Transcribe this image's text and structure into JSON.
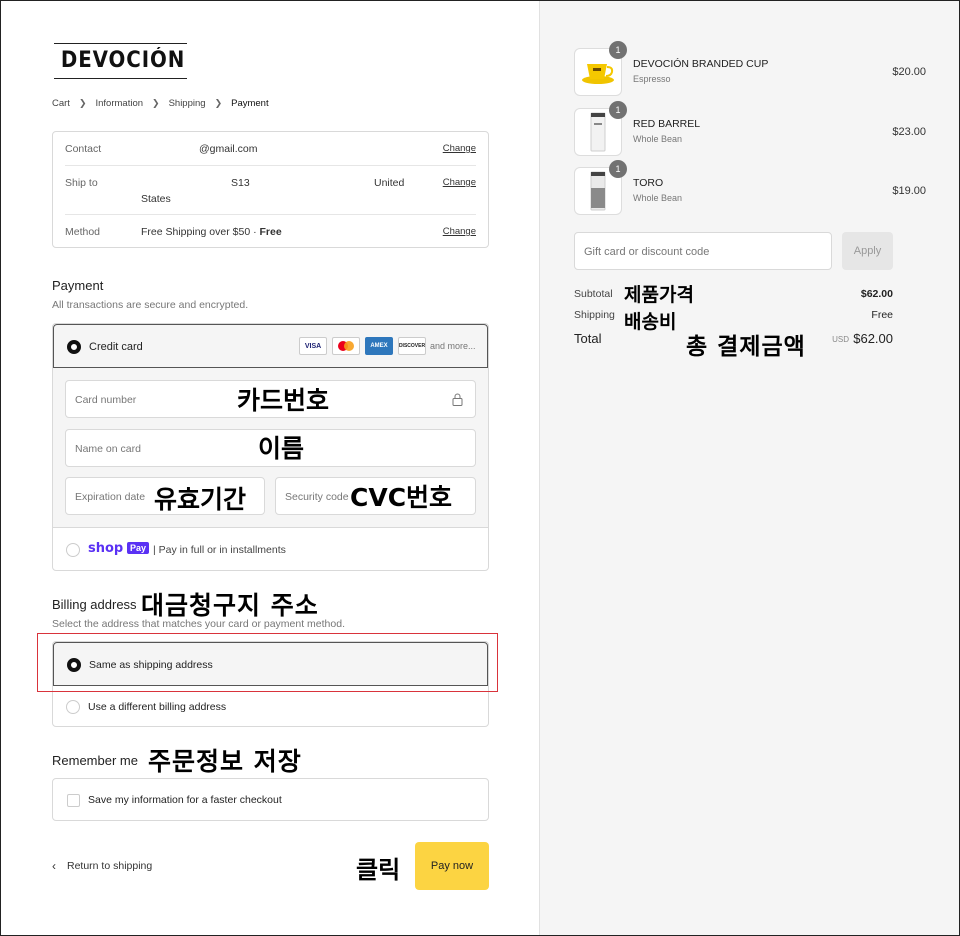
{
  "brand": {
    "logo_text": "DEVOCIÓN"
  },
  "breadcrumb": [
    "Cart",
    "Information",
    "Shipping",
    "Payment"
  ],
  "summary": {
    "contact_label": "Contact",
    "contact_value": "@gmail.com",
    "ship_label": "Ship to",
    "ship_value_a": "S13",
    "ship_value_b": "United",
    "ship_value_c": "States",
    "method_label": "Method",
    "method_value": "Free Shipping over $50 · ",
    "method_free": "Free",
    "change_label": "Change"
  },
  "payment": {
    "title": "Payment",
    "subtitle": "All transactions are secure and encrypted.",
    "credit_card_label": "Credit card",
    "card_brands": [
      "VISA",
      "MC",
      "AMEX",
      "DISCOVER"
    ],
    "and_more": "and more...",
    "card_number_placeholder": "Card number",
    "name_placeholder": "Name on card",
    "expiration_placeholder": "Expiration date",
    "security_placeholder": "Security code",
    "shoppay_logo": "shop",
    "shoppay_badge": "Pay",
    "shoppay_text": "| Pay in full or in installments"
  },
  "billing": {
    "title": "Billing address",
    "subtitle": "Select the address that matches your card or payment method.",
    "same_label": "Same as shipping address",
    "different_label": "Use a different billing address"
  },
  "remember": {
    "title": "Remember me",
    "save_label": "Save my information for a faster checkout"
  },
  "actions": {
    "return_label": "Return to shipping",
    "pay_label": "Pay now"
  },
  "annotations": {
    "card_number": "카드번호",
    "name": "이름",
    "expiration": "유효기간",
    "cvc": "CVC번호",
    "billing": "대금청구지 주소",
    "remember": "주문정보 저장",
    "click": "클릭",
    "subtotal": "제품가격",
    "shipping": "배송비",
    "total": "총 결제금액"
  },
  "cart": {
    "items": [
      {
        "name": "DEVOCIÓN BRANDED CUP",
        "variant": "Espresso",
        "qty": "1",
        "price": "$20.00"
      },
      {
        "name": "RED BARREL",
        "variant": "Whole Bean",
        "qty": "1",
        "price": "$23.00"
      },
      {
        "name": "TORO",
        "variant": "Whole Bean",
        "qty": "1",
        "price": "$19.00"
      }
    ],
    "discount_placeholder": "Gift card or discount code",
    "apply_label": "Apply",
    "subtotal_label": "Subtotal",
    "subtotal_value": "$62.00",
    "shipping_label": "Shipping",
    "shipping_value": "Free",
    "total_label": "Total",
    "currency": "USD",
    "total_value": "$62.00"
  },
  "colors": {
    "pay_button": "#fcd442",
    "highlight": "#d9333b",
    "shoppay": "#5a31f4"
  }
}
